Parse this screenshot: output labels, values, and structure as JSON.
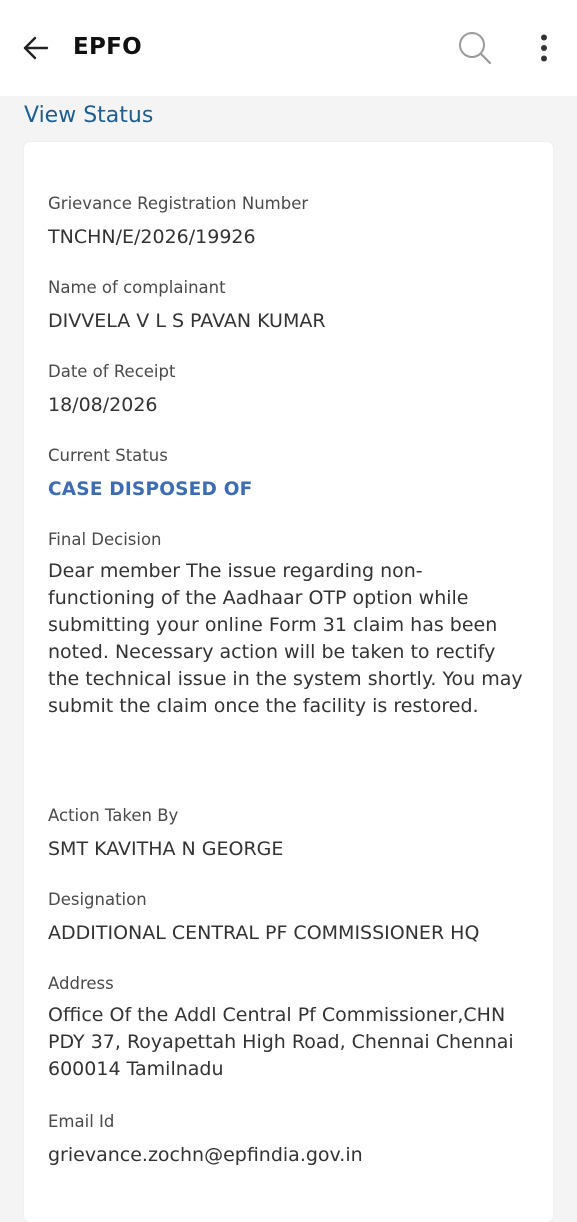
{
  "app_bar": {
    "title": "EPFO",
    "back_icon": "arrow-left-icon",
    "search_icon": "search-icon",
    "more_icon": "more-vertical-icon"
  },
  "page": {
    "section_title": "View Status"
  },
  "grievance": {
    "registration_number": {
      "label": "Grievance Registration Number",
      "value": "TNCHN/E/2026/19926"
    },
    "complainant": {
      "label": "Name of complainant",
      "value": "DIVVELA V L S PAVAN KUMAR"
    },
    "date_of_receipt": {
      "label": "Date of Receipt",
      "value": "18/08/2026"
    },
    "current_status": {
      "label": "Current Status",
      "value": "CASE DISPOSED OF"
    },
    "final_decision": {
      "label": "Final Decision",
      "value": "Dear member The issue regarding non-functioning of the Aadhaar OTP option while submitting your online Form 31 claim has been noted. Necessary action will be taken to rectify the technical issue in the system shortly. You may submit the claim once the facility is restored."
    },
    "action_taken_by": {
      "label": "Action Taken By",
      "value": "SMT KAVITHA N GEORGE"
    },
    "designation": {
      "label": "Designation",
      "value": "ADDITIONAL CENTRAL PF COMMISSIONER HQ"
    },
    "address": {
      "label": "Address",
      "value": "Office Of the Addl Central Pf Commissioner,CHN PDY 37, Royapettah High Road, Chennai Chennai 600014 Tamilnadu"
    },
    "email": {
      "label": "Email Id",
      "value": "grievance.zochn@epfindia.gov.in"
    }
  },
  "colors": {
    "accent_blue": "#1c5e92",
    "status_blue": "#3d6cb2",
    "background": "#f4f4f4",
    "card": "#ffffff"
  }
}
